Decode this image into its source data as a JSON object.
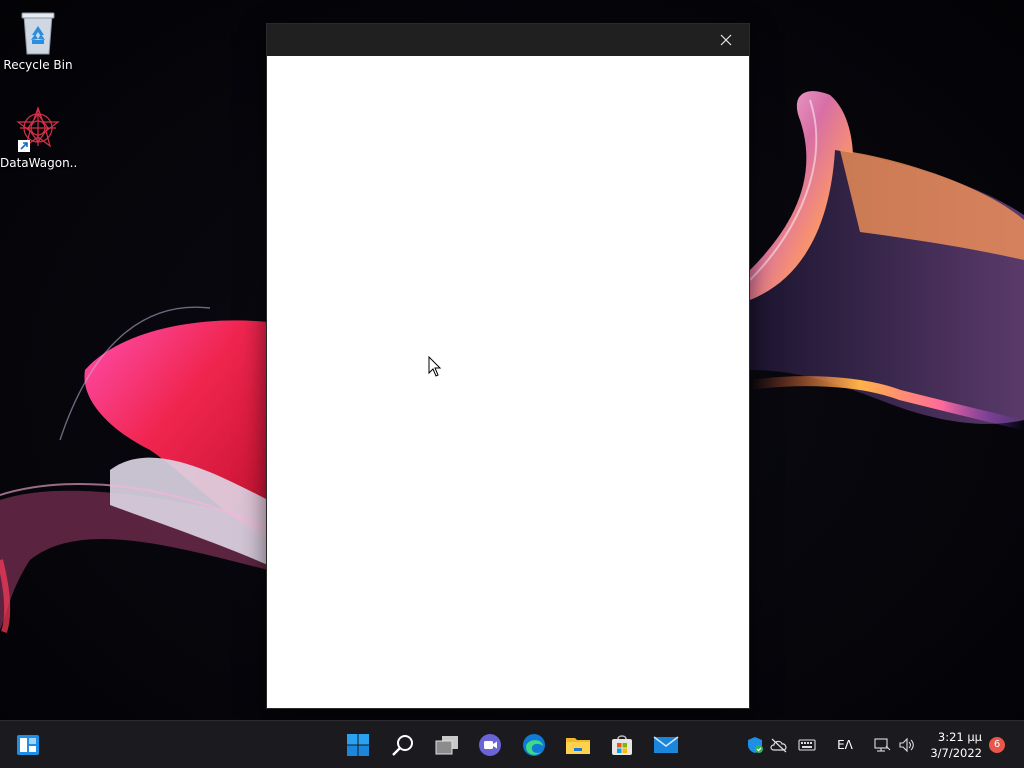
{
  "desktop": {
    "icons": [
      {
        "label": "Recycle Bin"
      },
      {
        "label": "DataWagon..."
      }
    ]
  },
  "window": {
    "close_glyph": "✕"
  },
  "taskbar": {
    "pinned": [
      "widgets-icon",
      "start-icon",
      "search-icon",
      "task-view-icon",
      "chat-icon",
      "edge-icon",
      "file-explorer-icon",
      "store-icon",
      "mail-icon"
    ],
    "tray": {
      "language": "ΕΛ",
      "time": "3:21 μμ",
      "date": "3/7/2022",
      "notifications": "6"
    }
  },
  "colors": {
    "accent": "#0a84d8",
    "taskbar_bg": "#1b1b1f",
    "window_title": "#202020",
    "badge": "#e8574a"
  }
}
